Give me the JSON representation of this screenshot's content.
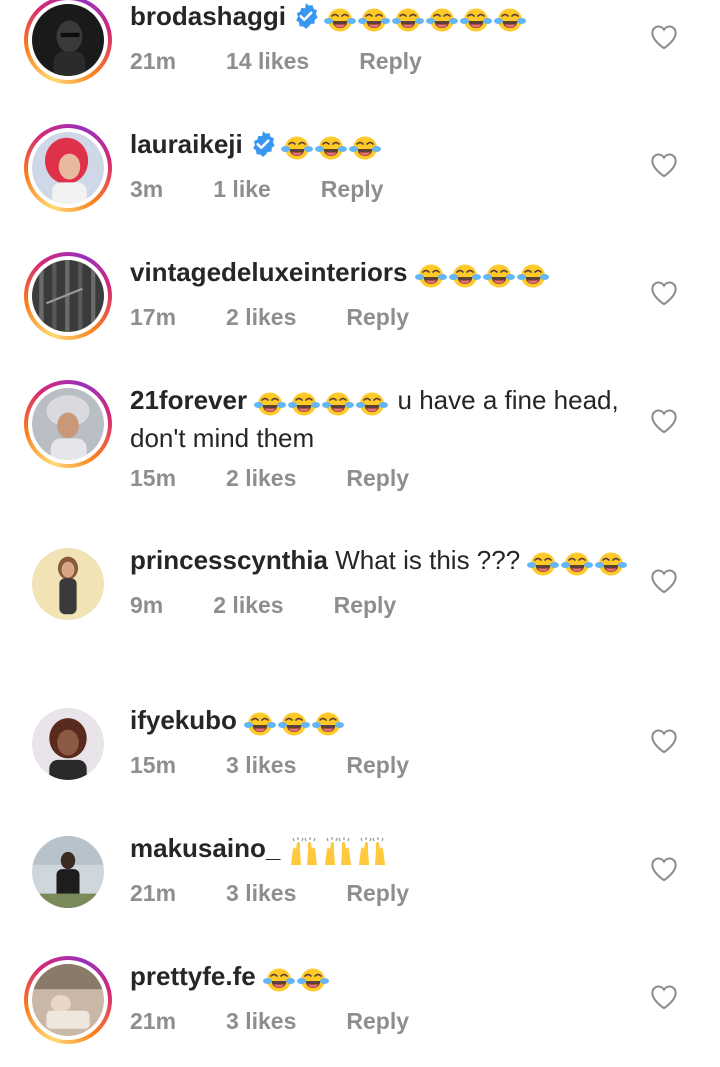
{
  "comments": [
    {
      "username": "brodashaggi",
      "verified": true,
      "emoji": "joy",
      "emoji_count": 6,
      "text": "",
      "time": "21m",
      "likes": "14 likes",
      "reply": "Reply",
      "ring": true,
      "avatar_icon": "avatar-photo-icon"
    },
    {
      "username": "lauraikeji",
      "verified": true,
      "emoji": "joy",
      "emoji_count": 3,
      "text": "",
      "time": "3m",
      "likes": "1 like",
      "reply": "Reply",
      "ring": true,
      "avatar_icon": "avatar-photo-icon"
    },
    {
      "username": "vintagedeluxeinteriors",
      "verified": false,
      "emoji": "joy",
      "emoji_count": 4,
      "text": "",
      "time": "17m",
      "likes": "2 likes",
      "reply": "Reply",
      "ring": true,
      "avatar_icon": "avatar-photo-icon"
    },
    {
      "username": "21forever",
      "verified": false,
      "emoji": "joy",
      "emoji_count": 4,
      "text": " u have a fine head, don't mind them",
      "time": "15m",
      "likes": "2 likes",
      "reply": "Reply",
      "ring": true,
      "avatar_icon": "avatar-photo-icon"
    },
    {
      "username": "princesscynthia",
      "verified": false,
      "emoji": "joy",
      "emoji_count": 3,
      "text": " What is this ??? ",
      "time": "9m",
      "likes": "2 likes",
      "reply": "Reply",
      "ring": false,
      "avatar_icon": "avatar-photo-icon"
    },
    {
      "username": "ifyekubo",
      "verified": false,
      "emoji": "joy",
      "emoji_count": 3,
      "text": "",
      "time": "15m",
      "likes": "3 likes",
      "reply": "Reply",
      "ring": false,
      "avatar_icon": "avatar-photo-icon"
    },
    {
      "username": "makusaino_",
      "verified": false,
      "emoji": "raised-hands",
      "emoji_count": 3,
      "text": "",
      "time": "21m",
      "likes": "3 likes",
      "reply": "Reply",
      "ring": false,
      "avatar_icon": "avatar-photo-icon"
    },
    {
      "username": "prettyfe.fe",
      "verified": false,
      "emoji": "joy",
      "emoji_count": 2,
      "text": "",
      "time": "21m",
      "likes": "3 likes",
      "reply": "Reply",
      "ring": true,
      "avatar_icon": "avatar-photo-icon"
    }
  ],
  "icons": {
    "like": "heart-outline-icon",
    "verified": "verified-badge-icon"
  },
  "colors": {
    "verified": "#3897f0",
    "meta": "#8e8e8e",
    "text": "#262626"
  }
}
